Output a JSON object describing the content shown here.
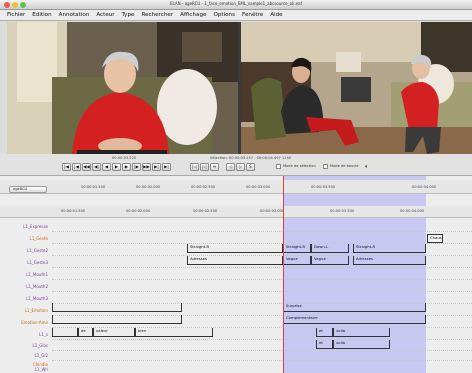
{
  "window": {
    "title": "ELAN - ageRCU - 1_face_emotion_EML_sample1_abcsource_ok.eaf"
  },
  "menu": [
    "Fichier",
    "Edition",
    "Annotation",
    "Acteur",
    "Type",
    "Rechercher",
    "Affichage",
    "Options",
    "Fenêtre",
    "Aide"
  ],
  "transport": {
    "current_time": "00:00:03.220",
    "selection": "Sélection: 00:00:03.257 - 00:00:04.497  1240",
    "buttons": [
      "|◀",
      "|◀",
      "◀◀",
      "◀|",
      "◀",
      "▶",
      "▶",
      "|▶",
      "▶▶",
      "▶|",
      "▶|"
    ],
    "nav_buttons": [
      "|◁",
      "▷|",
      "↔",
      "◁",
      "▷",
      "S"
    ],
    "mode_selection": "Mode de sélection",
    "mode_boucle": "Mode de boucle"
  },
  "ruler1": {
    "dropdown": "ageRCU",
    "ticks": [
      "00:00:01.500",
      "00:00:02.000",
      "00:00:02.500",
      "00:00:03.000",
      "00:00:03.500",
      "00:00:04.000"
    ]
  },
  "ruler2": {
    "ticks": [
      "00:00:01.500",
      "00:00:02.000",
      "00:00:02.500",
      "00:00:03.000",
      "00:00:03.500",
      "00:00:04.000"
    ]
  },
  "tiers": [
    {
      "name": "L1_Expresse",
      "color": "purple"
    },
    {
      "name": "L1_Geste",
      "color": "orange"
    },
    {
      "name": "L1_Geste2",
      "color": "purple"
    },
    {
      "name": "L1_Geste3",
      "color": "purple"
    },
    {
      "name": "L1_Mouth1",
      "color": "purple"
    },
    {
      "name": "L1_Mouth2",
      "color": "purple"
    },
    {
      "name": "L1_Mouth3",
      "color": "purple"
    },
    {
      "name": "L1_Emotion",
      "color": "orange"
    },
    {
      "name": "Emotion-Ame",
      "color": "orange"
    },
    {
      "name": "L1_s",
      "color": "purple"
    },
    {
      "name": "L1_Glos",
      "color": "purple"
    },
    {
      "name": "L1_Gl2",
      "color": "purple"
    },
    {
      "name": "Chindie",
      "color": "orange"
    },
    {
      "name": "L1_Wri",
      "color": "purple"
    }
  ],
  "annotations": {
    "a_chaus": "Chaus",
    "a_straight1": "Straight-R",
    "a_straight2": "Straight-R",
    "a_down": "Down-L",
    "a_straight3": "Straight-R",
    "a_adresse1": "Adresses",
    "a_vague": "Vague",
    "a_vague2": "Vague",
    "a_adresse2": "Adresses",
    "a_surprise": "Surprise",
    "a_complementaire": "Complementaire",
    "a_de": "de",
    "a_valeur": "valeur",
    "a_bien": "bien",
    "a_et1": "et",
    "a_voila1": "voila",
    "a_et2": "et",
    "a_voila2": "voila"
  },
  "colors": {
    "accent_selection": "#8c8cff",
    "cursor": "#e04040",
    "tier_purple": "#7a3ea0",
    "tier_orange": "#d06a10"
  }
}
